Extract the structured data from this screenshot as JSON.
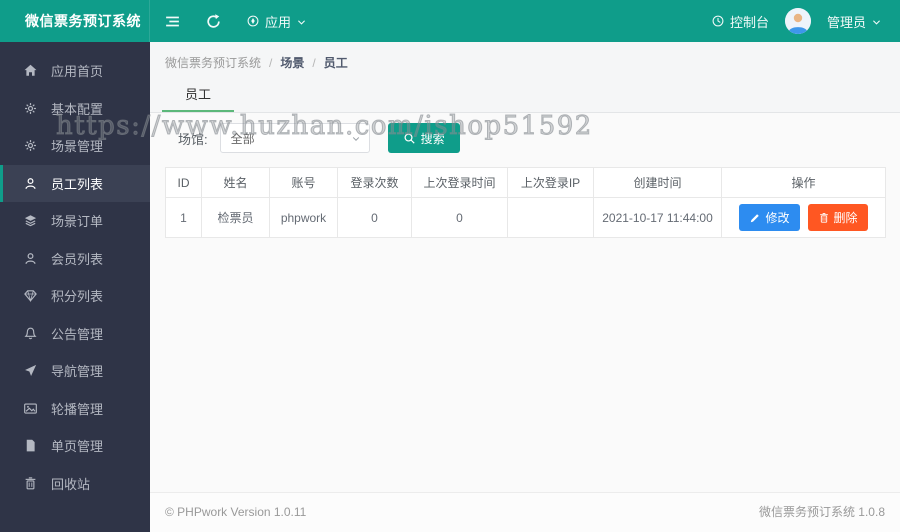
{
  "app": {
    "title": "微信票务预订系统"
  },
  "topbar": {
    "app_menu": "应用",
    "console": "控制台",
    "user": "管理员"
  },
  "sidebar": {
    "items": [
      {
        "label": "应用首页",
        "icon": "home",
        "active": false
      },
      {
        "label": "基本配置",
        "icon": "gear",
        "active": false
      },
      {
        "label": "场景管理",
        "icon": "gear",
        "active": false
      },
      {
        "label": "员工列表",
        "icon": "user",
        "active": true
      },
      {
        "label": "场景订单",
        "icon": "layers",
        "active": false
      },
      {
        "label": "会员列表",
        "icon": "user",
        "active": false
      },
      {
        "label": "积分列表",
        "icon": "gem",
        "active": false
      },
      {
        "label": "公告管理",
        "icon": "bell",
        "active": false
      },
      {
        "label": "导航管理",
        "icon": "send",
        "active": false
      },
      {
        "label": "轮播管理",
        "icon": "image",
        "active": false
      },
      {
        "label": "单页管理",
        "icon": "file",
        "active": false
      },
      {
        "label": "回收站",
        "icon": "trash",
        "active": false
      }
    ]
  },
  "breadcrumb": {
    "separator": "/",
    "items": [
      "微信票务预订系统",
      "场景",
      "员工"
    ]
  },
  "tabs": {
    "active": "员工"
  },
  "filter": {
    "label": "场馆:",
    "select_value": "全部",
    "search_label": "搜索"
  },
  "table": {
    "headers": [
      "ID",
      "姓名",
      "账号",
      "登录次数",
      "上次登录时间",
      "上次登录IP",
      "创建时间",
      "操作"
    ],
    "rows": [
      {
        "id": "1",
        "name": "检票员",
        "account": "phpwork",
        "login_count": "0",
        "last_login_time": "0",
        "last_login_ip": "",
        "created_at": "2021-10-17 11:44:00"
      }
    ],
    "actions": {
      "edit": "修改",
      "delete": "删除"
    }
  },
  "footer": {
    "left": "© PHPwork Version 1.0.11",
    "right": "微信票务预订系统 1.0.8"
  },
  "watermark": {
    "text": "https://www.huzhan.com/ishop51592"
  },
  "colors": {
    "primary": "#0f9d8a",
    "tab_underline": "#5cb87a",
    "edit_button": "#2d8cf0",
    "delete_button": "#ff5722",
    "sidebar_bg": "#2f3447"
  }
}
